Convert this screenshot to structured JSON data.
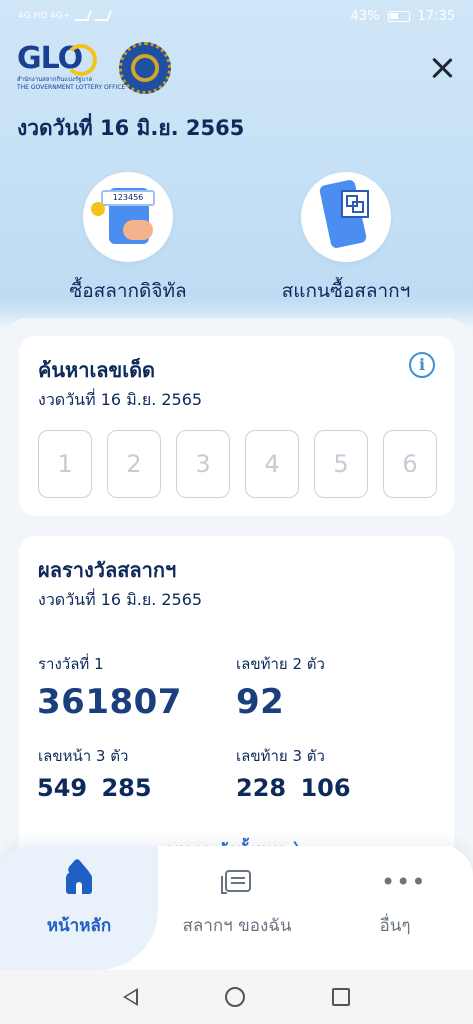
{
  "status_bar": {
    "carrier": "4G HD 4G+",
    "battery": "43%",
    "time": "17:35"
  },
  "header": {
    "logo_text": "GLO",
    "logo_subtitle": "สำนักงานสลากกินแบ่งรัฐบาล",
    "logo_subtitle_en": "THE GOVERNMENT LOTTERY OFFICE"
  },
  "draw_date": "งวดวันที่ 16 มิ.ย. 2565",
  "actions": [
    {
      "label": "ซื้อสลากดิจิทัล",
      "ticket_number": "123456"
    },
    {
      "label": "สแกนซื้อสลากฯ"
    }
  ],
  "search_card": {
    "title": "ค้นหาเลขเด็ด",
    "subtitle": "งวดวันที่  16 มิ.ย. 2565",
    "digits": [
      "1",
      "2",
      "3",
      "4",
      "5",
      "6"
    ]
  },
  "results_card": {
    "title": "ผลรางวัลสลากฯ",
    "subtitle": "งวดวันที่  16 มิ.ย. 2565",
    "first_prize_label": "รางวัลที่ 1",
    "first_prize": "361807",
    "last2_label": "เลขท้าย 2 ตัว",
    "last2": "92",
    "front3_label": "เลขหน้า 3 ตัว",
    "front3": "549  285",
    "last3_label": "เลขท้าย 3 ตัว",
    "last3": "228  106",
    "see_all": "ดูผลรางวัลทั้งหมด  〉"
  },
  "bottom_nav": [
    {
      "label": "หน้าหลัก",
      "icon": "home-icon",
      "active": true
    },
    {
      "label": "สลากฯ ของฉัน",
      "icon": "tickets-icon",
      "active": false
    },
    {
      "label": "อื่นๆ",
      "icon": "more-icon",
      "active": false
    }
  ],
  "colors": {
    "primary": "#1f5fc4",
    "text_dark": "#0d2a5b",
    "accent_yellow": "#f3c21b"
  }
}
